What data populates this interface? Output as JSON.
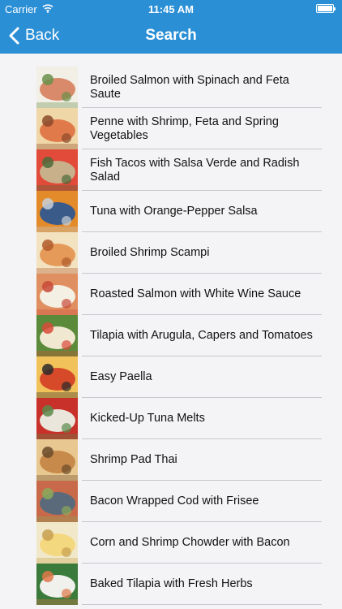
{
  "status": {
    "carrier": "Carrier",
    "time": "11:45 AM"
  },
  "nav": {
    "back_label": "Back",
    "title": "Search"
  },
  "results": [
    {
      "title": "Broiled Salmon with Spinach and Feta Saute",
      "colors": [
        "#d98a6a",
        "#f2efe6",
        "#6a8f4a"
      ]
    },
    {
      "title": "Penne with Shrimp, Feta and Spring Vegetables",
      "colors": [
        "#e07a4a",
        "#f0d7a8",
        "#8b4a2a"
      ]
    },
    {
      "title": "Fish Tacos with Salsa Verde and Radish Salad",
      "colors": [
        "#c7b08a",
        "#e24a3a",
        "#4d6b3a"
      ]
    },
    {
      "title": "Tuna with Orange-Pepper Salsa",
      "colors": [
        "#3a5a8a",
        "#e38a2a",
        "#c8d0d8"
      ]
    },
    {
      "title": "Broiled Shrimp Scampi",
      "colors": [
        "#e59a5a",
        "#f2e2c0",
        "#b25a2a"
      ]
    },
    {
      "title": "Roasted Salmon with White Wine Sauce",
      "colors": [
        "#f4f0e4",
        "#e09060",
        "#c84a3a"
      ]
    },
    {
      "title": "Tilapia with Arugula, Capers and Tomatoes",
      "colors": [
        "#f0e8d0",
        "#5a8a3a",
        "#d94a3a"
      ]
    },
    {
      "title": "Easy Paella",
      "colors": [
        "#d64a2a",
        "#f2c25a",
        "#2a2a2a"
      ]
    },
    {
      "title": "Kicked-Up Tuna Melts",
      "colors": [
        "#eae6dc",
        "#c8302a",
        "#5a8a4a"
      ]
    },
    {
      "title": "Shrimp Pad Thai",
      "colors": [
        "#c88a4a",
        "#e8c890",
        "#6a4a2a"
      ]
    },
    {
      "title": "Bacon Wrapped Cod with Frisee",
      "colors": [
        "#5a6a7a",
        "#c86a4a",
        "#8aaa5a"
      ]
    },
    {
      "title": "Corn and Shrimp Chowder with Bacon",
      "colors": [
        "#f4d880",
        "#f0e8c8",
        "#c8a050"
      ]
    },
    {
      "title": "Baked Tilapia with Fresh Herbs",
      "colors": [
        "#f0f0ec",
        "#3a7a3a",
        "#e0784a"
      ]
    }
  ]
}
